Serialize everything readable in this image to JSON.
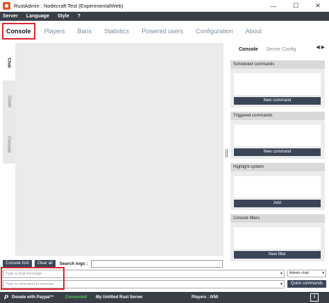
{
  "window": {
    "title": "RustAdmin : Nodecraft Test (ExperimentalWeb)",
    "minimize": "—",
    "maximize": "☐",
    "close": "✕"
  },
  "menu": [
    "Server",
    "Language",
    "Style",
    "?"
  ],
  "tabs": [
    "Console",
    "Players",
    "Bans",
    "Statistics",
    "Powered users",
    "Configuration",
    "About"
  ],
  "side_tabs": [
    "Chat",
    "Oxide",
    "Console"
  ],
  "right_tabs": [
    "Console",
    "Server Config"
  ],
  "right_arrows": "◀ ▶",
  "panels": [
    {
      "title": "Scheduled commands",
      "button": "New command"
    },
    {
      "title": "Triggered commands",
      "button": "New command"
    },
    {
      "title": "Highlight system",
      "button": "Add"
    },
    {
      "title": "Console filters",
      "button": "New filter"
    }
  ],
  "bottom": {
    "console_font": "Console font",
    "clear_all": "Clear all",
    "search_label": "Search logs :",
    "chat_placeholder": "Type a chat message",
    "command_placeholder": "Type a command to execute",
    "chat_mode": "Admin chat",
    "quick_commands": "Quick commands"
  },
  "status": {
    "donate": "Donate with Paypal™",
    "connected": "Connected",
    "server_name": "My Untitled Rust Server",
    "players": "Players : 0/50",
    "info": "i"
  },
  "colors": {
    "accent_red": "#d9262c",
    "dark": "#3a4658",
    "connected_green": "#4ccb52"
  }
}
